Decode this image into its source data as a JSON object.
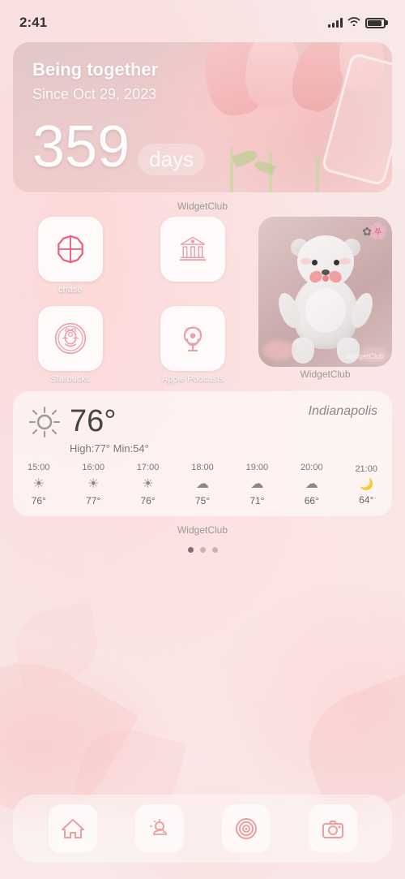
{
  "statusBar": {
    "time": "2:41",
    "signalBars": [
      4,
      6,
      8,
      10,
      12
    ],
    "battery": 90
  },
  "countdownWidget": {
    "title": "Being together",
    "subtitle": "Since Oct 29, 2023",
    "number": "359",
    "unit": "days",
    "label": "WidgetClub"
  },
  "apps": {
    "chase": {
      "label": "chase"
    },
    "bank": {
      "label": ""
    },
    "starbucks": {
      "label": "Starbucks"
    },
    "podcasts": {
      "label": "Apple Podcasts"
    }
  },
  "photoWidget": {
    "label": "WidgetClub"
  },
  "weather": {
    "city": "Indianapolis",
    "temp": "76°",
    "highLow": "High:77°  Min:54°",
    "label": "WidgetClub",
    "hourly": [
      {
        "time": "15:00",
        "icon": "☀",
        "temp": "76°"
      },
      {
        "time": "16:00",
        "icon": "☀",
        "temp": "77°"
      },
      {
        "time": "17:00",
        "icon": "☀",
        "temp": "76°"
      },
      {
        "time": "18:00",
        "icon": "☁",
        "temp": "75°"
      },
      {
        "time": "19:00",
        "icon": "☁",
        "temp": "71°"
      },
      {
        "time": "20:00",
        "icon": "☁",
        "temp": "66°"
      },
      {
        "time": "21:00",
        "icon": "🌙",
        "temp": "64°"
      }
    ]
  },
  "pageDots": {
    "count": 3,
    "active": 0
  },
  "dock": {
    "items": [
      {
        "name": "home",
        "icon": "home-icon"
      },
      {
        "name": "weather",
        "icon": "weather-icon"
      },
      {
        "name": "target",
        "icon": "target-icon"
      },
      {
        "name": "camera",
        "icon": "camera-icon"
      }
    ]
  }
}
